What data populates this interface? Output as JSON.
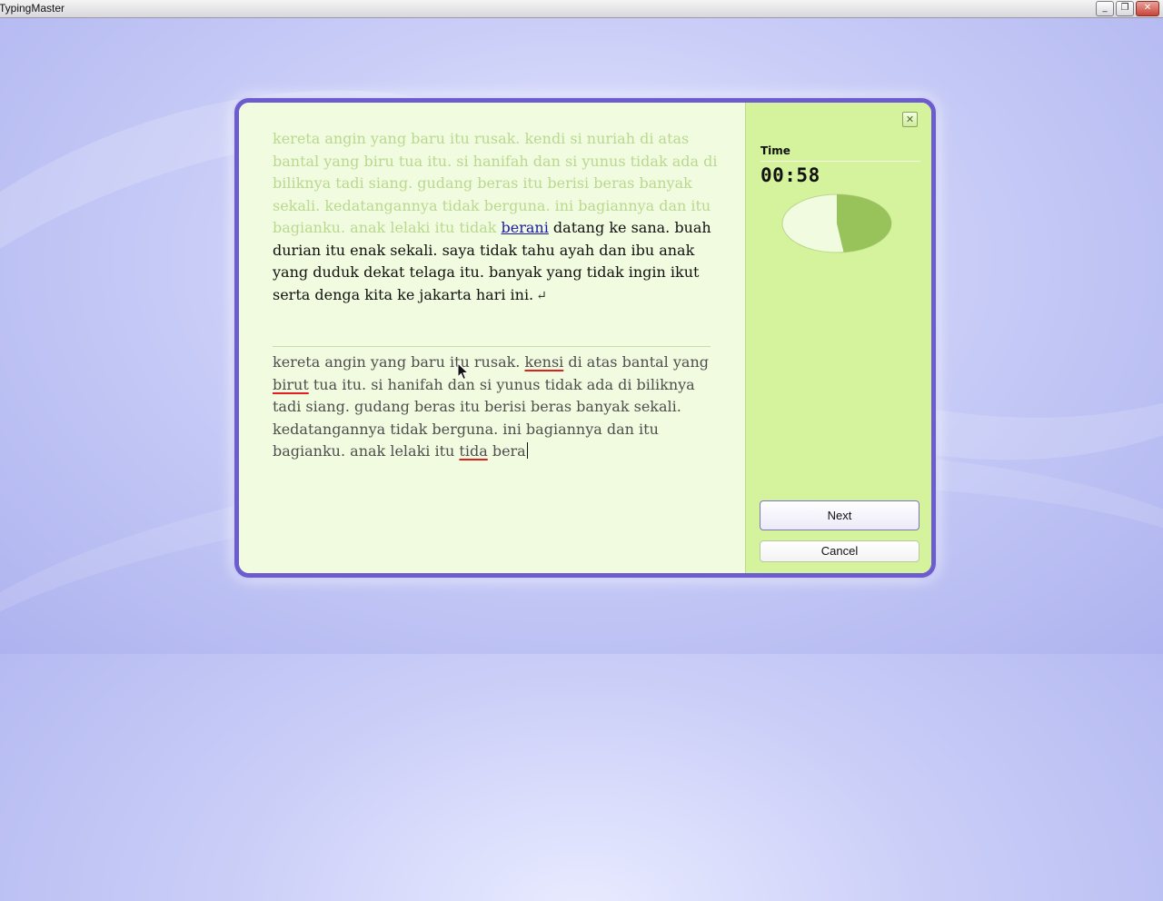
{
  "window": {
    "title": "TypingMaster",
    "minimize_glyph": "_",
    "restore_glyph": "❐",
    "close_glyph": "✕"
  },
  "exercise": {
    "source_done": "kereta angin yang baru itu rusak. kendi si nuriah di atas bantal yang biru tua itu. si hanifah dan si yunus tidak ada di biliknya tadi siang. gudang beras itu berisi beras banyak sekali. kedatangannya tidak berguna. ini bagiannya dan itu bagianku. anak lelaki itu tidak ",
    "source_current_word": "berani",
    "source_remaining": " datang ke sana. buah durian itu enak sekali. saya tidak tahu ayah dan ibu anak yang duduk dekat telaga itu. banyak yang tidak ingin ikut serta denga kita ke jakarta hari ini.",
    "enter_symbol": "↵",
    "typed_segments": [
      {
        "text": "kereta angin yang baru itu rusak. ",
        "error": false
      },
      {
        "text": "kensi",
        "error": true
      },
      {
        "text": " di atas bantal yang ",
        "error": false
      },
      {
        "text": "birut",
        "error": true
      },
      {
        "text": " tua itu. si hanifah dan si yunus tidak ada di biliknya tadi siang. gudang beras itu berisi beras banyak sekali. kedatangannya tidak berguna. ini bagiannya dan itu bagianku. anak lelaki itu ",
        "error": false
      },
      {
        "text": "tida",
        "error": true
      },
      {
        "text": " bera",
        "error": false
      }
    ]
  },
  "timer": {
    "label": "Time",
    "value": "00:58",
    "elapsed_fraction": 0.48
  },
  "buttons": {
    "close_glyph": "✕",
    "next_label": "Next",
    "cancel_label": "Cancel"
  },
  "colors": {
    "dialog_border": "#6c5cd0",
    "pie_elapsed": "#98c25a",
    "pie_remaining": "#f1fbdf",
    "error_underline": "#e02020"
  }
}
